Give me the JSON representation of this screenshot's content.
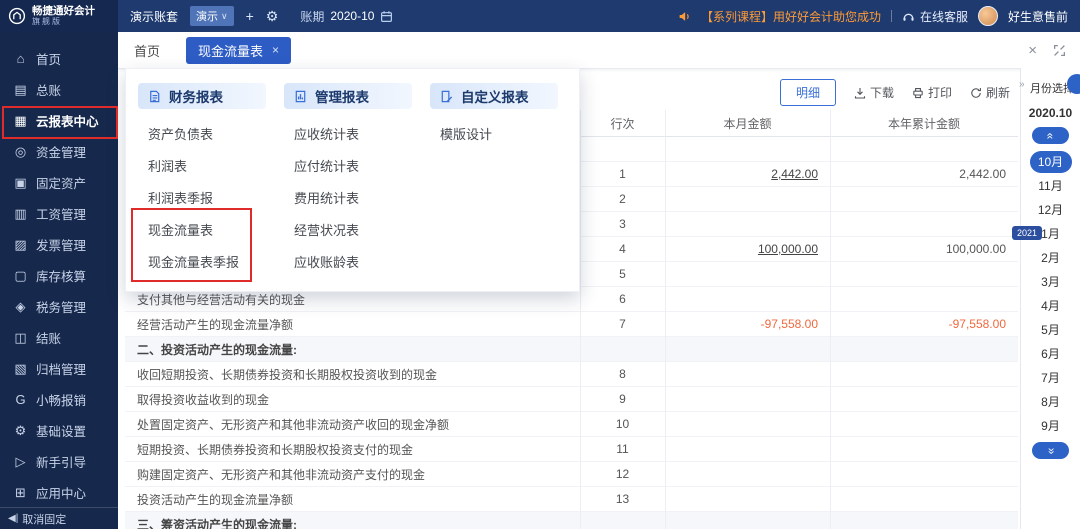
{
  "topbar": {
    "logo_title": "畅捷通好会计",
    "logo_subtitle": "旗舰版",
    "account_set": "演示账套",
    "demo_tag": "演示",
    "period_label": "账期",
    "period_value": "2020-10",
    "promo": "【系列课程】用好好会计助您成功",
    "online_service": "在线客服",
    "username": "好生意售前"
  },
  "tabs": {
    "home": "首页",
    "active": "现金流量表"
  },
  "icons": {
    "plus-icon": "+",
    "gear-icon": "⚙",
    "close-icon": "×",
    "collapse-handle-icon": "»",
    "scroll-up-icon": "«",
    "scroll-down-icon": "«",
    "unpin-icon": "◀|",
    "demo-chevron-icon": "∨"
  },
  "sidebar": {
    "items": [
      {
        "label": "首页",
        "icon": "home-icon"
      },
      {
        "label": "总账",
        "icon": "ledger-icon"
      },
      {
        "label": "云报表中心",
        "icon": "cloud-report-icon",
        "selected": true
      },
      {
        "label": "资金管理",
        "icon": "funds-icon"
      },
      {
        "label": "固定资产",
        "icon": "fixed-assets-icon"
      },
      {
        "label": "工资管理",
        "icon": "salary-icon"
      },
      {
        "label": "发票管理",
        "icon": "invoice-icon"
      },
      {
        "label": "库存核算",
        "icon": "inventory-icon"
      },
      {
        "label": "税务管理",
        "icon": "tax-icon"
      },
      {
        "label": "结账",
        "icon": "closing-icon"
      },
      {
        "label": "归档管理",
        "icon": "archive-icon"
      },
      {
        "label": "小畅报销",
        "icon": "reimburse-icon"
      },
      {
        "label": "基础设置",
        "icon": "settings-icon"
      },
      {
        "label": "新手引导",
        "icon": "guide-icon"
      },
      {
        "label": "应用中心",
        "icon": "apps-icon"
      }
    ],
    "pin_label": "取消固定"
  },
  "megamenu": {
    "columns": [
      {
        "title": "财务报表",
        "icon": "finance-report-icon",
        "items": [
          "资产负债表",
          "利润表",
          "利润表季报",
          "现金流量表",
          "现金流量表季报"
        ]
      },
      {
        "title": "管理报表",
        "icon": "management-report-icon",
        "items": [
          "应收统计表",
          "应付统计表",
          "费用统计表",
          "经营状况表",
          "应收账龄表"
        ]
      },
      {
        "title": "自定义报表",
        "icon": "custom-report-icon",
        "items": [
          "模版设计"
        ]
      }
    ]
  },
  "toolbar": {
    "detail": "明细",
    "download": "下载",
    "print": "打印",
    "refresh": "刷新"
  },
  "table": {
    "headers": {
      "project": "",
      "line": "行次",
      "month": "本月金额",
      "year": "本年累计金额"
    },
    "rows": [
      {
        "name": "",
        "line": "",
        "month": "",
        "year": ""
      },
      {
        "name": "",
        "line": "1",
        "month": "2,442.00",
        "year": "2,442.00",
        "month_link": true
      },
      {
        "name": "",
        "line": "2",
        "month": "",
        "year": ""
      },
      {
        "name": "",
        "line": "3",
        "month": "",
        "year": ""
      },
      {
        "name": "",
        "line": "4",
        "month": "100,000.00",
        "year": "100,000.00",
        "month_link": true
      },
      {
        "name": "",
        "line": "5",
        "month": "",
        "year": ""
      },
      {
        "name": "支付其他与经营活动有关的现金",
        "line": "6",
        "month": "",
        "year": ""
      },
      {
        "name": "经营活动产生的现金流量净额",
        "line": "7",
        "month": "-97,558.00",
        "year": "-97,558.00",
        "negative": true
      },
      {
        "name": "二、投资活动产生的现金流量:",
        "line": "",
        "month": "",
        "year": "",
        "section": true
      },
      {
        "name": "收回短期投资、长期债券投资和长期股权投资收到的现金",
        "line": "8",
        "month": "",
        "year": ""
      },
      {
        "name": "取得投资收益收到的现金",
        "line": "9",
        "month": "",
        "year": ""
      },
      {
        "name": "处置固定资产、无形资产和其他非流动资产收回的现金净额",
        "line": "10",
        "month": "",
        "year": ""
      },
      {
        "name": "短期投资、长期债券投资和长期股权投资支付的现金",
        "line": "11",
        "month": "",
        "year": ""
      },
      {
        "name": "购建固定资产、无形资产和其他非流动资产支付的现金",
        "line": "12",
        "month": "",
        "year": ""
      },
      {
        "name": "投资活动产生的现金流量净额",
        "line": "13",
        "month": "",
        "year": ""
      },
      {
        "name": "三、筹资活动产生的现金流量:",
        "line": "",
        "month": "",
        "year": "",
        "section": true
      }
    ]
  },
  "month_panel": {
    "title": "月份选择",
    "current": "2020.10",
    "year_badge": "2021",
    "selected": "10月",
    "months": [
      "10月",
      "11月",
      "12月",
      "1月",
      "2月",
      "3月",
      "4月",
      "5月",
      "6月",
      "7月",
      "8月",
      "9月"
    ]
  },
  "colors": {
    "accent_blue": "#2d5cc5",
    "dark_navy": "#1e3a6e",
    "sidebar_navy": "#16294d",
    "promo_orange": "#ff9b37",
    "negative_orange": "#f0683f",
    "annotation_red": "#e02b2b"
  }
}
